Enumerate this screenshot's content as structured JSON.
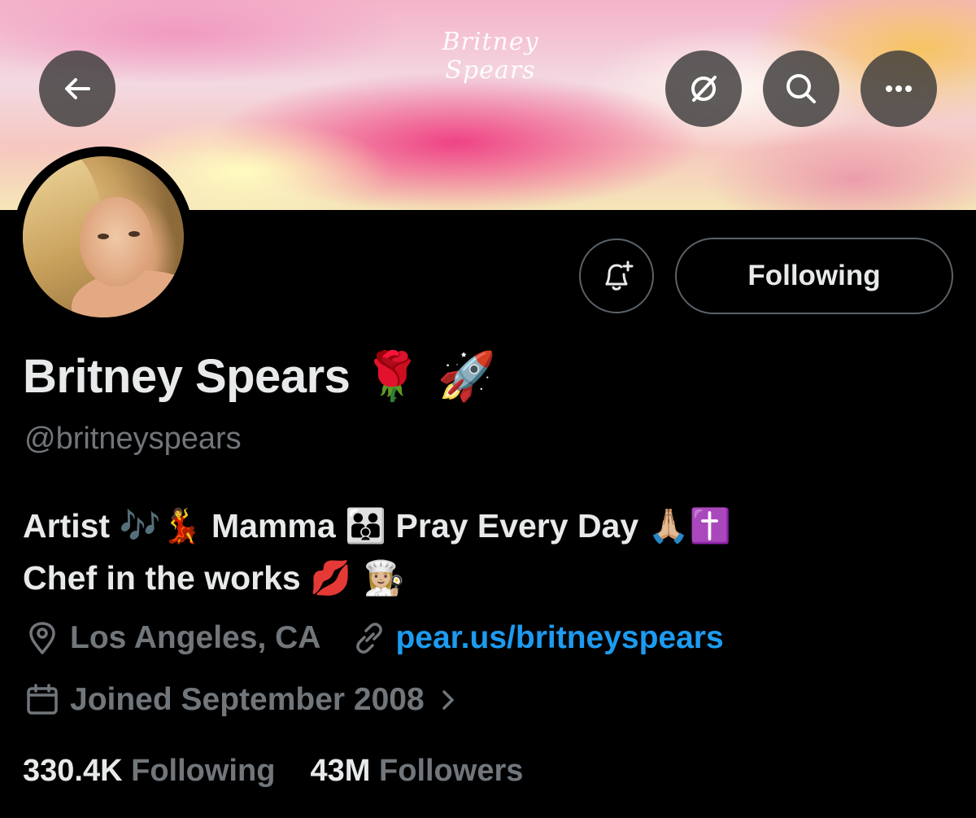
{
  "banner": {
    "logo_text": "Britney Spears"
  },
  "header": {
    "back_icon": "arrow-left-icon",
    "grok_icon": "grok-icon",
    "search_icon": "search-icon",
    "more_icon": "more-icon"
  },
  "actions": {
    "notify_icon": "bell-plus-icon",
    "follow_label": "Following"
  },
  "profile": {
    "name": "Britney Spears",
    "name_emojis": "🌹 🚀",
    "handle": "@britneyspears",
    "bio_line1_a": "Artist",
    "bio_line1_e1": "🎶💃",
    "bio_line1_b": "Mamma",
    "bio_line1_e2": "👪",
    "bio_line1_c": "Pray Every Day",
    "bio_line1_e3": "🙏🏼✝️",
    "bio_line2_a": "Chef in the works",
    "bio_line2_e": "💋 👩🏼‍🍳",
    "location": "Los Angeles, CA",
    "website": "pear.us/britneyspears",
    "joined": "Joined September 2008"
  },
  "stats": {
    "following_count": "330.4K",
    "following_label": "Following",
    "followers_count": "43M",
    "followers_label": "Followers"
  },
  "colors": {
    "background": "#000000",
    "text": "#e7e9ea",
    "muted": "#71767b",
    "link": "#1d9bf0",
    "border": "#5b6268"
  }
}
